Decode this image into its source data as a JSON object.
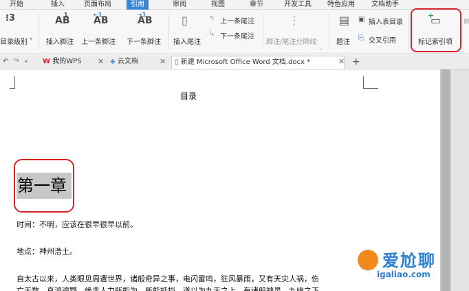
{
  "menu_tabs": [
    "开始",
    "插入",
    "页面布局",
    "引用",
    "审阅",
    "视图",
    "章节",
    "开发工具",
    "特色应用",
    "文档助手"
  ],
  "active_menu_tab": "引用",
  "ribbon": {
    "toc_level": "目录级别",
    "insert_footnote": "插入脚注",
    "prev_footnote": "上一条脚注",
    "next_footnote": "下一条脚注",
    "insert_endnote": "插入尾注",
    "prev_endnote": "上一条尾注",
    "next_endnote": "下一条尾注",
    "footnote_separator": "脚注/尾注分隔线",
    "caption": "题注",
    "insert_table_of_figures": "插入表目录",
    "cross_reference": "交叉引用",
    "mark_index_entry": "标记索引项"
  },
  "doc_tabs": [
    {
      "label": "我的WPS"
    },
    {
      "label": "云文档"
    },
    {
      "label": "新建 Microsoft Office Word 文档.docx *"
    }
  ],
  "document": {
    "toc_title": "目录",
    "chapter_heading": "第一章",
    "lines": [
      "时间：不明，应该在很早很早以前。",
      "地点：神州浩土。",
      "自太古以来，人类眼见周遭世界，诸般奇异之事，电闪雷鸣，狂风暴雨，又有天灾人祸，伤",
      "亡无数，哀鸿遍野，绝非人力所能为，所能抵挡。遂以为九天之上，有诸般神灵，九幽之下，"
    ]
  },
  "watermark": {
    "brand": "爱尬聊",
    "url": "igaliao.com"
  },
  "colors": {
    "accent": "#3a86d6",
    "highlight_box": "#d8232a",
    "selection": "#c7c7c7"
  }
}
